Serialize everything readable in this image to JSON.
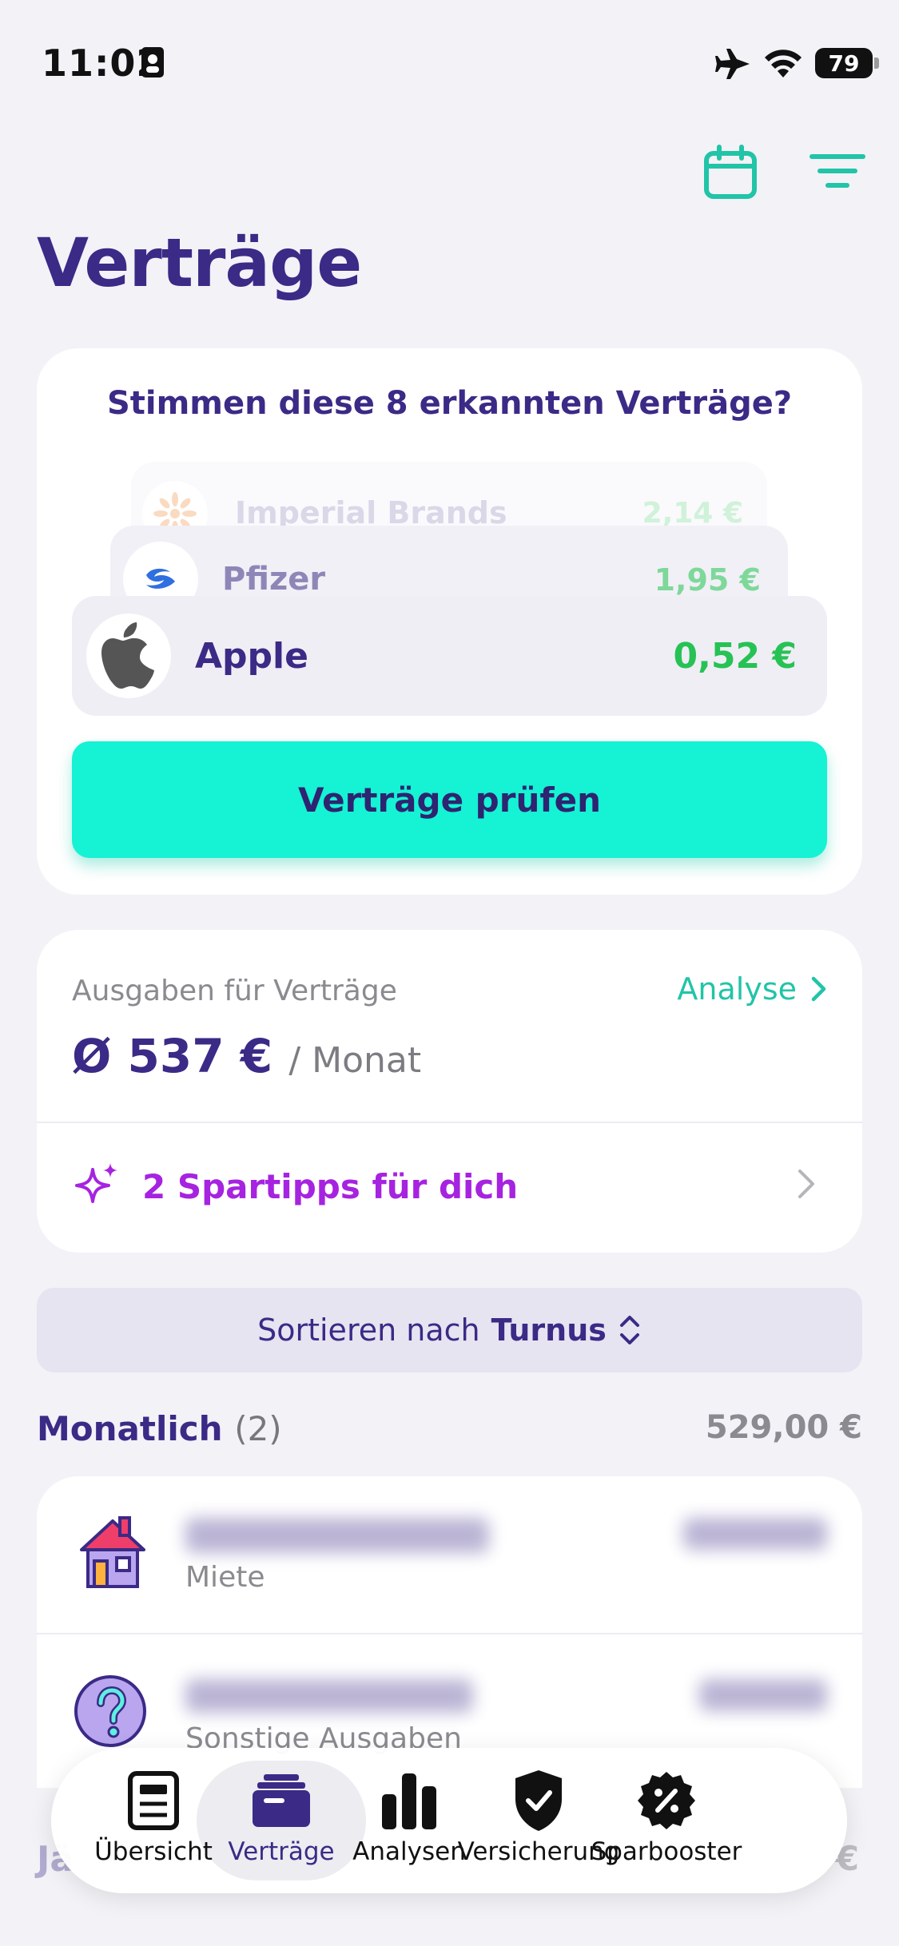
{
  "status": {
    "time": "11:02",
    "battery": "79"
  },
  "page": {
    "title": "Verträge"
  },
  "detected": {
    "title": "Stimmen diese 8 erkannten Verträge?",
    "items": [
      {
        "name": "Imperial Brands",
        "amount": "2,14 €"
      },
      {
        "name": "Pfizer",
        "amount": "1,95 €"
      },
      {
        "name": "Apple",
        "amount": "0,52 €"
      }
    ],
    "cta_label": "Verträge prüfen"
  },
  "spending": {
    "label": "Ausgaben für Verträge",
    "link_label": "Analyse",
    "amount": "Ø 537 €",
    "unit": "/ Monat",
    "tips_label": "2 Spartipps für dich"
  },
  "sort": {
    "prefix": "Sortieren nach",
    "value": "Turnus"
  },
  "group": {
    "title": "Monatlich",
    "count": "(2)",
    "total": "529,00 €"
  },
  "rows": [
    {
      "category": "Miete"
    },
    {
      "category": "Sonstige Ausgaben"
    }
  ],
  "behind": {
    "label": "Jä",
    "amount": "€"
  },
  "tabs": [
    {
      "label": "Übersicht",
      "icon": "document-icon"
    },
    {
      "label": "Verträge",
      "icon": "contracts-icon"
    },
    {
      "label": "Analysen",
      "icon": "bar-chart-icon"
    },
    {
      "label": "Versicherung",
      "icon": "shield-check-icon"
    },
    {
      "label": "Sparbooster",
      "icon": "percent-badge-icon"
    }
  ],
  "colors": {
    "primary": "#3b2a86",
    "accent": "#15f2d4",
    "teal": "#22c4a8",
    "purple": "#a623e0",
    "green": "#27c255"
  }
}
